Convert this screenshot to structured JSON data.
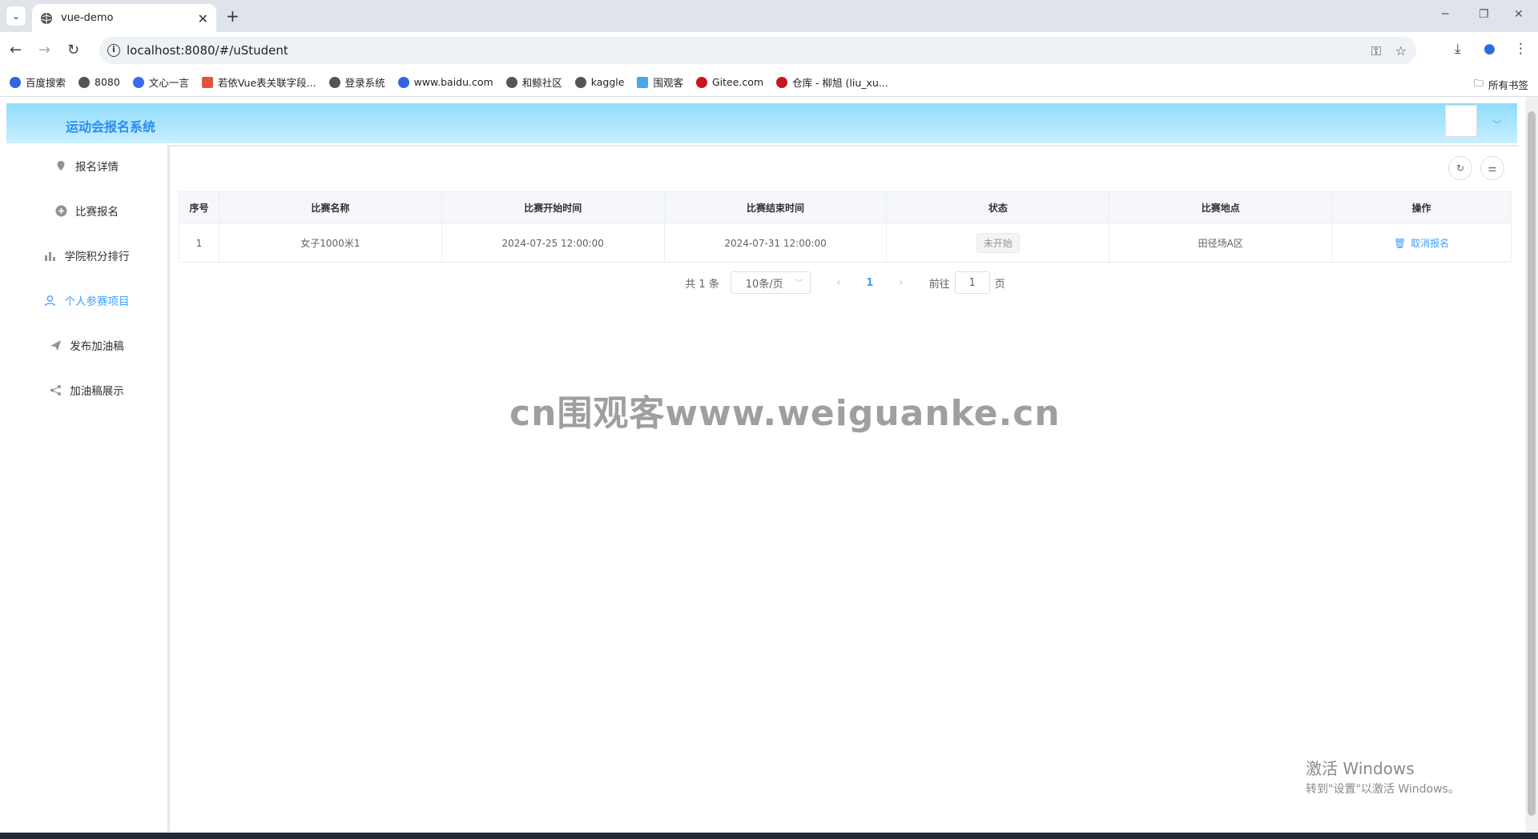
{
  "browser": {
    "tab_title": "vue-demo",
    "url": "localhost:8080/#/uStudent",
    "bookmarks": [
      "百度搜索",
      "8080",
      "文心一言",
      "若依Vue表关联字段...",
      "登录系统",
      "www.baidu.com",
      "和鲸社区",
      "kaggle",
      "围观客",
      "Gitee.com",
      "仓库 - 柳旭 (liu_xu..."
    ],
    "all_bookmarks": "所有书签"
  },
  "app": {
    "title": "运动会报名系统"
  },
  "sidebar": {
    "items": [
      {
        "label": "报名详情",
        "icon": "location-pin-icon"
      },
      {
        "label": "比赛报名",
        "icon": "plus-circle-icon"
      },
      {
        "label": "学院积分排行",
        "icon": "bar-chart-icon"
      },
      {
        "label": "个人参赛项目",
        "icon": "user-icon"
      },
      {
        "label": "发布加油稿",
        "icon": "send-icon"
      },
      {
        "label": "加油稿展示",
        "icon": "share-icon"
      }
    ],
    "active_index": 3
  },
  "table": {
    "headers": [
      "序号",
      "比赛名称",
      "比赛开始时间",
      "比赛结束时间",
      "状态",
      "比赛地点",
      "操作"
    ],
    "rows": [
      {
        "index": "1",
        "name": "女子1000米1",
        "start": "2024-07-25 12:00:00",
        "end": "2024-07-31 12:00:00",
        "status": "未开始",
        "location": "田径场A区",
        "action": "取消报名"
      }
    ]
  },
  "pagination": {
    "total": "共 1 条",
    "page_size": "10条/页",
    "current_page": "1",
    "goto_label": "前往",
    "goto_value": "1",
    "page_suffix": "页"
  },
  "overlay": {
    "watermark": "cn围观客www.weiguanke.cn",
    "windows_line1": "激活 Windows",
    "windows_line2": "转到\"设置\"以激活 Windows。"
  },
  "colors": {
    "accent": "#409eff",
    "header_gradient_top": "#8fdcfb",
    "header_gradient_bottom": "#c9efff"
  }
}
